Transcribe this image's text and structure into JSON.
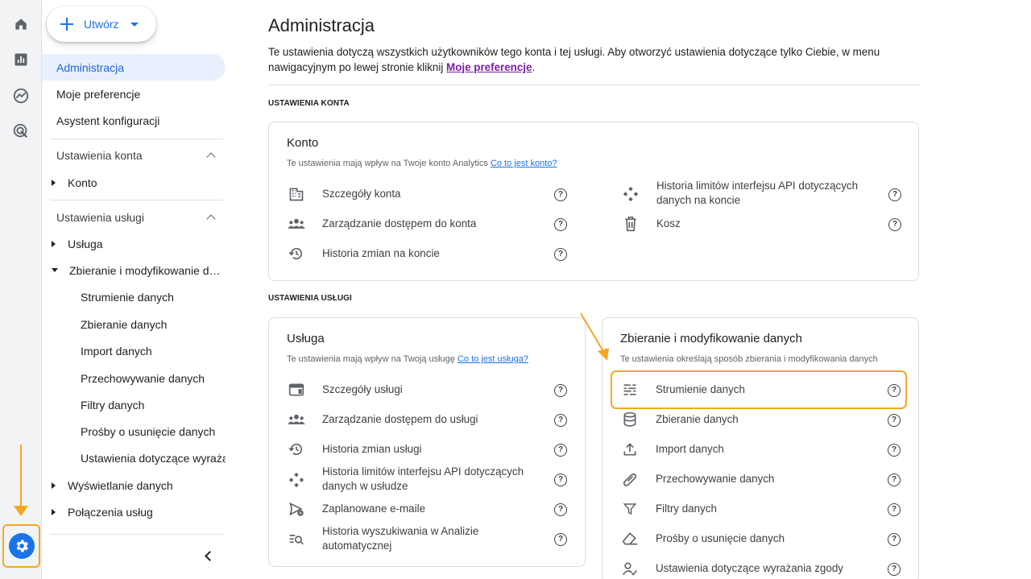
{
  "create": {
    "label": "Utwórz"
  },
  "rail": {
    "items": [
      {
        "icon": "home-icon"
      },
      {
        "icon": "reports-icon"
      },
      {
        "icon": "explore-icon"
      },
      {
        "icon": "advertising-icon"
      }
    ],
    "settings_icon": "gear-icon"
  },
  "sidebar": {
    "administracja": "Administracja",
    "preferencje": "Moje preferencje",
    "asystent": "Asystent konfiguracji",
    "section_konto": "Ustawienia konta",
    "konto": "Konto",
    "section_usluga": "Ustawienia usługi",
    "usluga": "Usługa",
    "zbieranie_group": "Zbieranie i modyfikowanie danych",
    "sub": [
      "Strumienie danych",
      "Zbieranie danych",
      "Import danych",
      "Przechowywanie danych",
      "Filtry danych",
      "Prośby o usunięcie danych",
      "Ustawienia dotyczące wyrażania zgody"
    ],
    "wyswietlanie": "Wyświetlanie danych",
    "polaczenia": "Połączenia usług"
  },
  "main": {
    "title": "Administracja",
    "intro_text": "Te ustawienia dotyczą wszystkich użytkowników tego konta i tej usługi. Aby otworzyć ustawienia dotyczące tylko Ciebie, w menu nawigacyjnym po lewej stronie kliknij ",
    "intro_link": "Moje preferencje",
    "intro_end": ".",
    "section_konto": "USTAWIENIA KONTA",
    "section_usluga": "USTAWIENIA USŁUGI"
  },
  "card_konto": {
    "title": "Konto",
    "sub": "Te ustawienia mają wpływ na Twoje konto Analytics ",
    "sub_link": "Co to jest konto?",
    "left": [
      {
        "icon": "building-icon",
        "label": "Szczegóły konta"
      },
      {
        "icon": "people-icon",
        "label": "Zarządzanie dostępem do konta"
      },
      {
        "icon": "history-icon",
        "label": "Historia zmian na koncie"
      }
    ],
    "right": [
      {
        "icon": "api-quota-icon",
        "label": "Historia limitów interfejsu API dotyczących danych na koncie"
      },
      {
        "icon": "trash-icon",
        "label": "Kosz"
      }
    ]
  },
  "card_usluga": {
    "title": "Usługa",
    "sub": "Te ustawienia mają wpływ na Twoją usługę ",
    "sub_link": "Co to jest usługa?",
    "rows": [
      {
        "icon": "property-details-icon",
        "label": "Szczegóły usługi"
      },
      {
        "icon": "people-icon",
        "label": "Zarządzanie dostępem do usługi"
      },
      {
        "icon": "history-icon",
        "label": "Historia zmian usługi"
      },
      {
        "icon": "api-quota-icon",
        "label": "Historia limitów interfejsu API dotyczących danych w usłudze"
      },
      {
        "icon": "scheduled-email-icon",
        "label": "Zaplanowane e-maile"
      },
      {
        "icon": "search-history-icon",
        "label": "Historia wyszukiwania w Analizie automatycznej"
      }
    ]
  },
  "card_zbieranie": {
    "title": "Zbieranie i modyfikowanie danych",
    "sub": "Te ustawienia określają sposób zbierania i modyfikowania danych",
    "rows": [
      {
        "icon": "data-streams-icon",
        "label": "Strumienie danych"
      },
      {
        "icon": "database-icon",
        "label": "Zbieranie danych"
      },
      {
        "icon": "upload-icon",
        "label": "Import danych"
      },
      {
        "icon": "retention-icon",
        "label": "Przechowywanie danych"
      },
      {
        "icon": "filter-icon",
        "label": "Filtry danych"
      },
      {
        "icon": "eraser-icon",
        "label": "Prośby o usunięcie danych"
      },
      {
        "icon": "consent-icon",
        "label": "Ustawienia dotyczące wyrażania zgody"
      }
    ]
  },
  "help_glyph": "?",
  "colors": {
    "accent": "#1a73e8",
    "highlight": "#f5a623",
    "link_visited": "#7b1fa2"
  }
}
